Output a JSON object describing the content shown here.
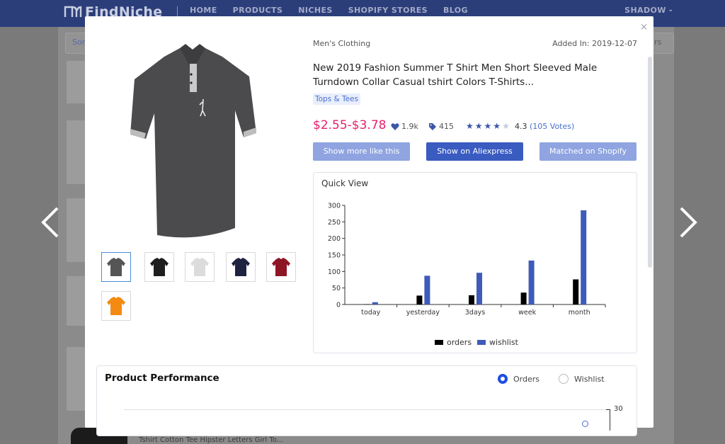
{
  "nav": {
    "brand": "FindNiche",
    "links": [
      "HOME",
      "PRODUCTS",
      "NICHES",
      "SHOPIFY STORES",
      "BLOG"
    ],
    "user": "SHADOW -"
  },
  "background": {
    "sort_label": "Sor",
    "sort_right": "rs",
    "bottom_item_title": "Tshirt Cotton Tee Hipster Letters Girl To..."
  },
  "product": {
    "category": "Men's Clothing",
    "added": "Added In: 2019-12-07",
    "title": "New 2019 Fashion Summer T Shirt Men Short Sleeved Male Turndown Collar Casual tshirt Colors T-Shirts...",
    "tag": "Tops & Tees",
    "price": "$2.55-$3.78",
    "likes": "1.9k",
    "tags_count": "415",
    "rating": "4.3",
    "votes": "(105 Votes)",
    "star_count": 4.3,
    "thumb_colors": [
      "#555555",
      "#1e1e1e",
      "#dcdcdc",
      "#1f2340",
      "#8e1524",
      "#f38a12"
    ],
    "accent_price": "#e8216a"
  },
  "buttons": {
    "more_like": "Show more like this",
    "aliexpress": "Show on Aliexpress",
    "shopify": "Matched on Shopify"
  },
  "quick_view": {
    "title": "Quick View",
    "legend_orders": "orders",
    "legend_wishlist": "wishlist"
  },
  "chart_data": {
    "type": "bar",
    "categories": [
      "today",
      "yesterday",
      "3days",
      "week",
      "month"
    ],
    "series": [
      {
        "name": "orders",
        "values": [
          1,
          27,
          28,
          36,
          76
        ],
        "color": "#000000"
      },
      {
        "name": "wishlist",
        "values": [
          7,
          87,
          96,
          133,
          285
        ],
        "color": "#3f5bb9"
      }
    ],
    "yticks": [
      0,
      50,
      100,
      150,
      200,
      250,
      300
    ],
    "ylim": [
      0,
      300
    ],
    "legend": "bottom"
  },
  "performance": {
    "title": "Product Performance",
    "radio_orders": "Orders",
    "radio_wishlist": "Wishlist",
    "axis_value": "30"
  }
}
